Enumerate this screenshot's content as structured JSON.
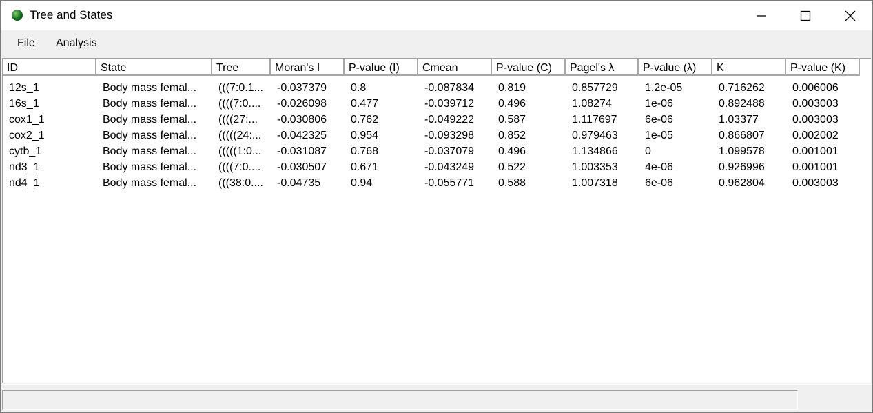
{
  "window": {
    "title": "Tree and States",
    "icon": "globe-icon",
    "controls": [
      "minimize-icon",
      "maximize-icon",
      "close-icon"
    ]
  },
  "menu": {
    "file_label": "File",
    "analysis_label": "Analysis"
  },
  "table": {
    "headers": [
      "ID",
      "State",
      "Tree",
      "Moran's I",
      "P-value (I)",
      "Cmean",
      "P-value (C)",
      "Pagel's λ",
      "P-value (λ)",
      "K",
      "P-value (K)"
    ],
    "rows": [
      [
        "12s_1",
        "Body mass femal...",
        "(((7:0.1...",
        "-0.037379",
        "0.8",
        "-0.087834",
        "0.819",
        "0.857729",
        "1.2e-05",
        "0.716262",
        "0.006006"
      ],
      [
        "16s_1",
        "Body mass femal...",
        "((((7:0....",
        "-0.026098",
        "0.477",
        "-0.039712",
        "0.496",
        "1.08274",
        "1e-06",
        "0.892488",
        "0.003003"
      ],
      [
        "cox1_1",
        "Body mass femal...",
        "((((27:...",
        "-0.030806",
        "0.762",
        "-0.049222",
        "0.587",
        "1.117697",
        "6e-06",
        "1.03377",
        "0.003003"
      ],
      [
        "cox2_1",
        "Body mass femal...",
        "(((((24:...",
        "-0.042325",
        "0.954",
        "-0.093298",
        "0.852",
        "0.979463",
        "1e-05",
        "0.866807",
        "0.002002"
      ],
      [
        "cytb_1",
        "Body mass femal...",
        "(((((1:0...",
        "-0.031087",
        "0.768",
        "-0.037079",
        "0.496",
        "1.134866",
        "0",
        "1.099578",
        "0.001001"
      ],
      [
        "nd3_1",
        "Body mass femal...",
        "((((7:0....",
        "-0.030507",
        "0.671",
        "-0.043249",
        "0.522",
        "1.003353",
        "4e-06",
        "0.926996",
        "0.001001"
      ],
      [
        "nd4_1",
        "Body mass femal...",
        "(((38:0....",
        "-0.04735",
        "0.94",
        "-0.055771",
        "0.588",
        "1.007318",
        "6e-06",
        "0.962804",
        "0.003003"
      ]
    ]
  },
  "status": {
    "text": ""
  }
}
